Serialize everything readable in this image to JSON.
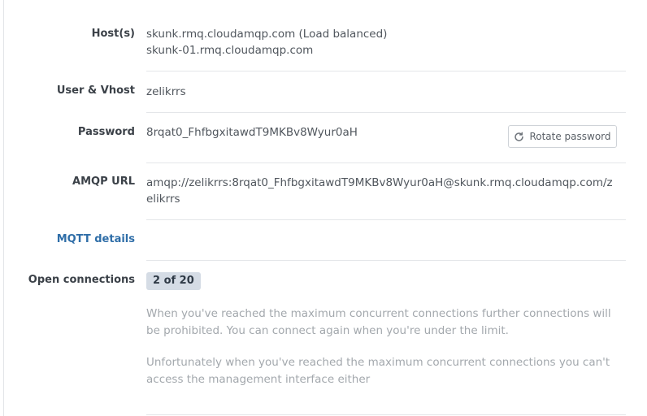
{
  "hosts": {
    "label": "Host(s)",
    "primary": "skunk.rmq.cloudamqp.com (Load balanced)",
    "secondary": "skunk-01.rmq.cloudamqp.com"
  },
  "user_vhost": {
    "label": "User & Vhost",
    "value": "zelikrrs"
  },
  "password": {
    "label": "Password",
    "value": "8rqat0_FhfbgxitawdT9MKBv8Wyur0aH",
    "rotate_button": {
      "label": "Rotate password",
      "icon": "refresh-icon"
    }
  },
  "amqp_url": {
    "label": "AMQP URL",
    "value": "amqp://zelikrrs:8rqat0_FhfbgxitawdT9MKBv8Wyur0aH@skunk.rmq.cloudamqp.com/zelikrrs"
  },
  "mqtt": {
    "link_label": "MQTT details"
  },
  "open_connections": {
    "label": "Open connections",
    "badge": "2 of 20",
    "note_1": "When you've reached the maximum concurrent connections further connections will be prohibited. You can connect again when you're under the limit.",
    "note_2": "Unfortunately when you've reached the maximum concurrent connections you can't access the management interface either"
  },
  "colors": {
    "link": "#2f6ea8",
    "badge_bg": "#d5dce5",
    "muted_text": "#a3a8ad"
  }
}
